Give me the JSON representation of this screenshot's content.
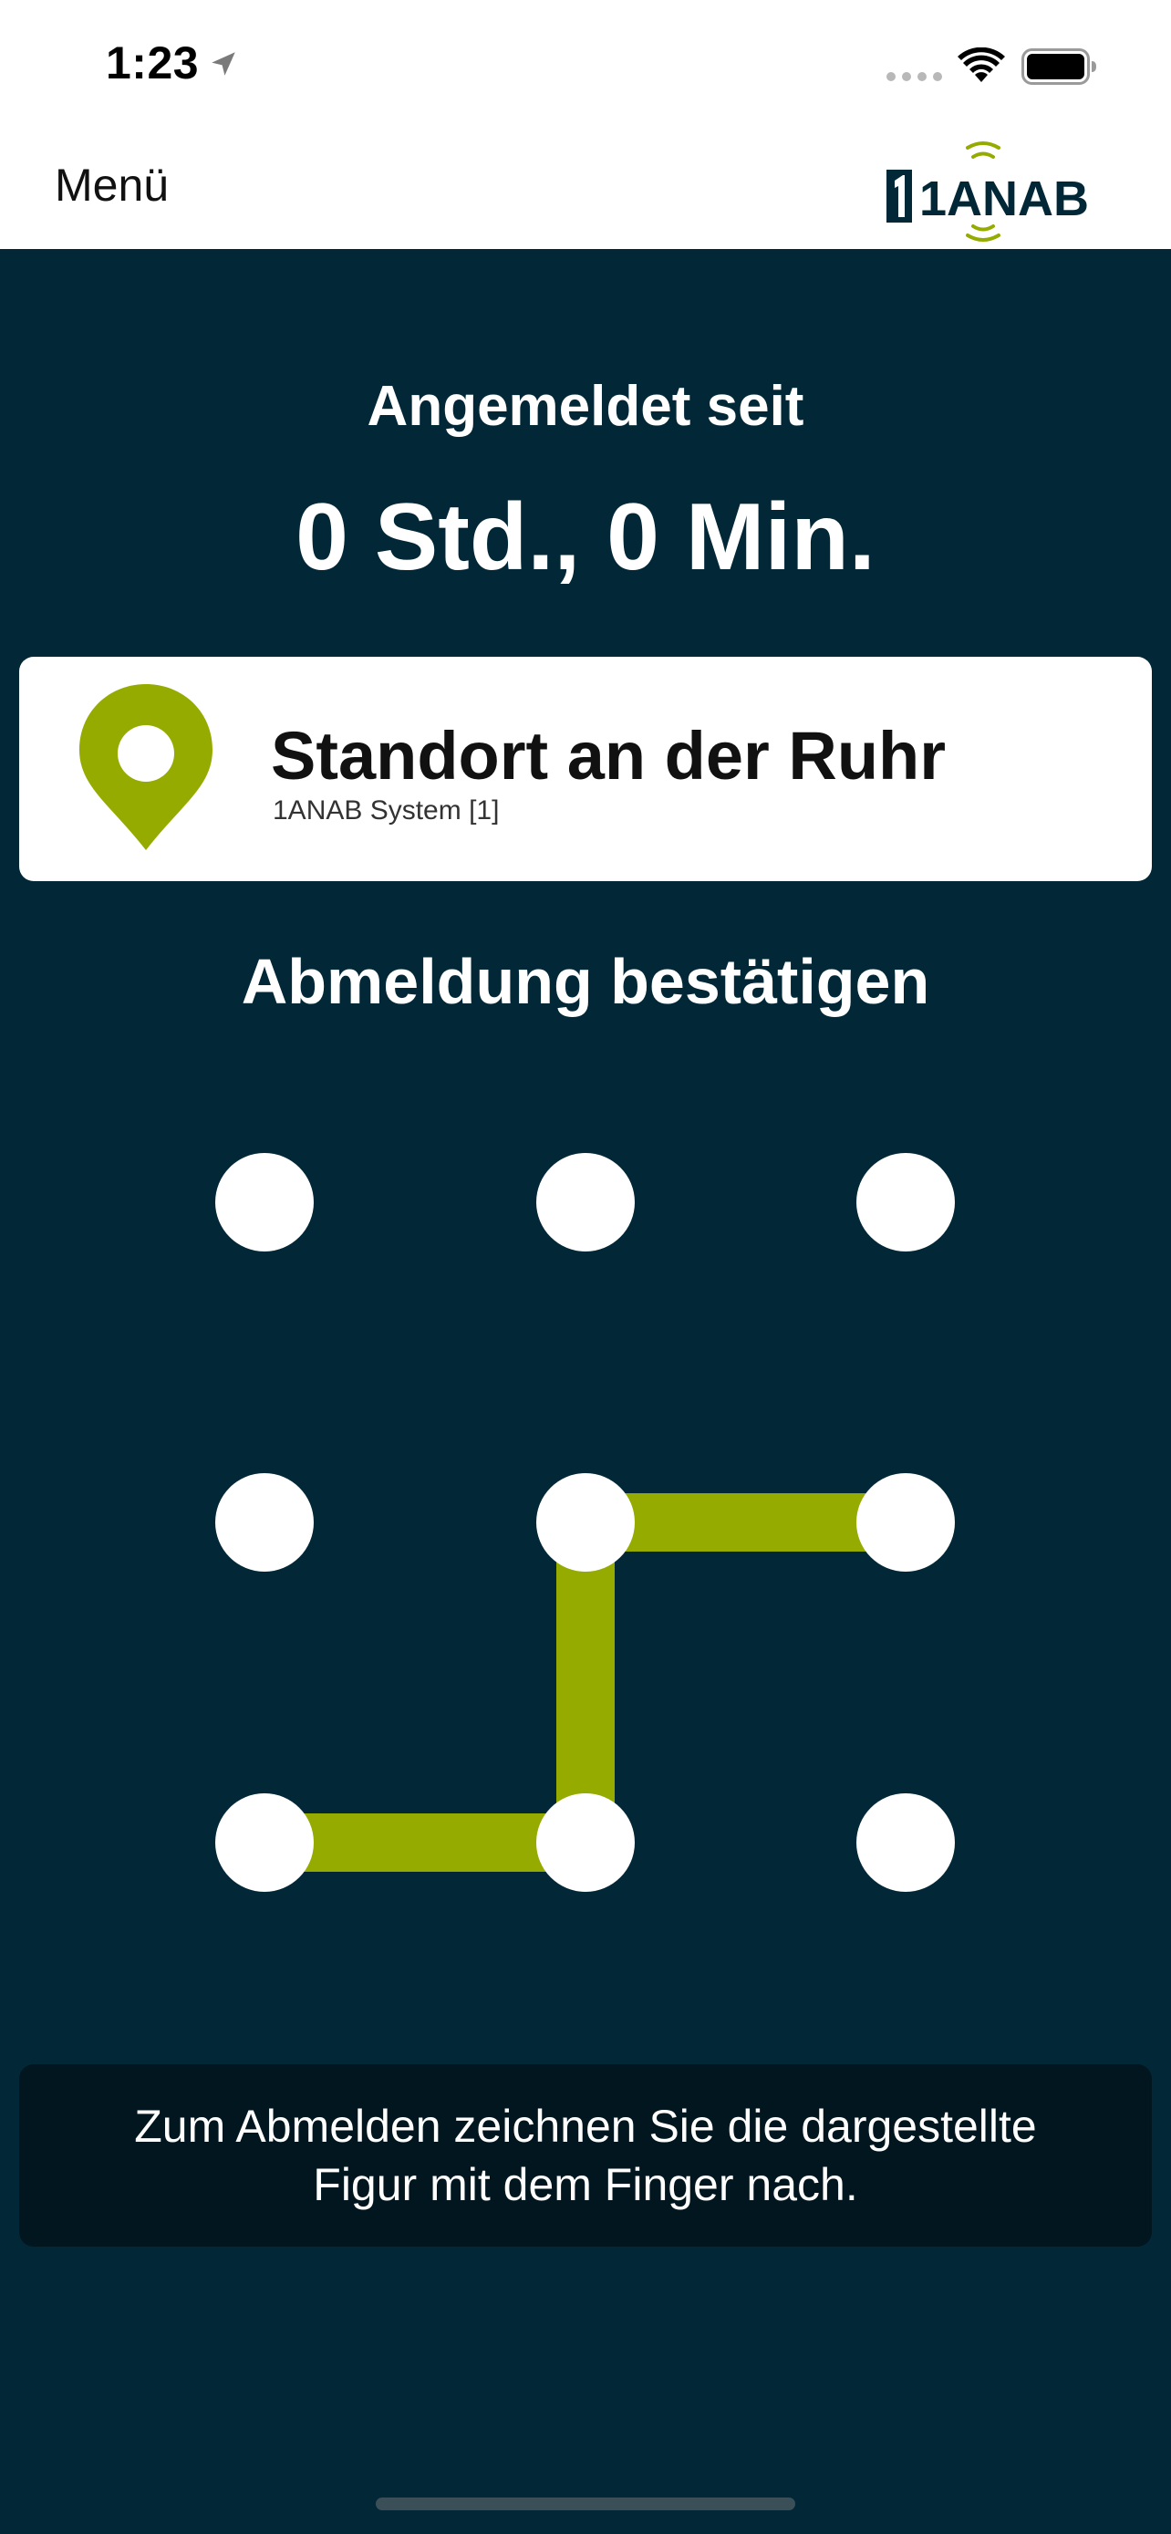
{
  "status_bar": {
    "time": "1:23",
    "icons": [
      "location-arrow-icon",
      "signal-dots-icon",
      "wifi-icon",
      "battery-icon"
    ]
  },
  "nav_bar": {
    "menu_label": "Menü",
    "logo_text": "1ANAB",
    "logo_icon": "signal-waves-icon"
  },
  "session": {
    "since_label": "Angemeldet seit",
    "duration": "0 Std., 0 Min."
  },
  "location": {
    "icon": "map-pin-icon",
    "name": "Standort an der Ruhr",
    "system": "1ANAB System [1]"
  },
  "logout": {
    "title": "Abmeldung bestätigen",
    "pattern_path": [
      7,
      4,
      5
    ],
    "pattern_full_path": [
      6,
      7,
      4,
      5
    ],
    "hint": "Zum Abmelden zeichnen Sie die dargestellte Figur mit dem Finger nach."
  },
  "colors": {
    "background": "#022838",
    "accent": "#95ab00",
    "hint_bg": "#01161f",
    "white": "#ffffff"
  }
}
